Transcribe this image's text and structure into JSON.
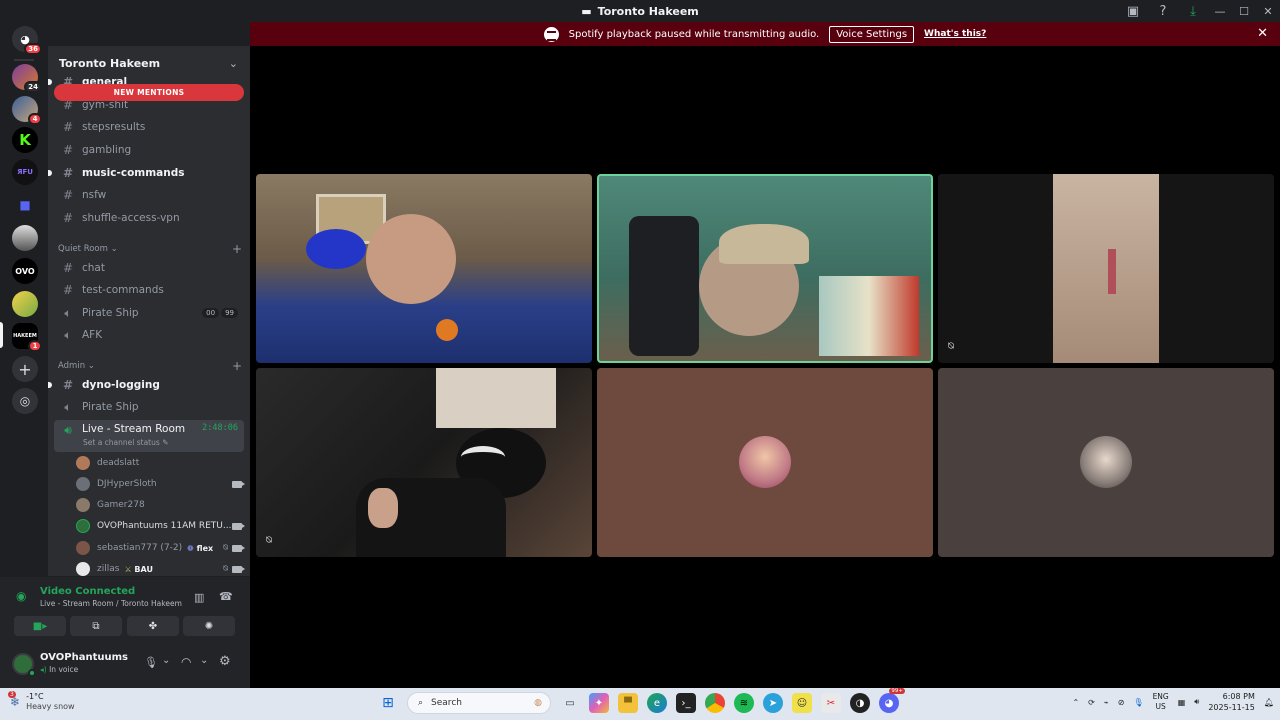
{
  "window": {
    "title": "Toronto Hakeem"
  },
  "notice": {
    "message": "Spotify playback paused while transmitting audio.",
    "button": "Voice Settings",
    "link": "What's this?"
  },
  "rail": {
    "dm_badge": "36",
    "server_badges": {
      "s1": "24",
      "s2": "4",
      "s3": "1"
    }
  },
  "server": {
    "name": "Toronto Hakeem",
    "new_mentions": "NEW MENTIONS"
  },
  "channels_top": [
    {
      "name": "general",
      "type": "text",
      "unread": true
    },
    {
      "name": "gym-shit",
      "type": "text",
      "unread": false
    },
    {
      "name": "stepsresults",
      "type": "text",
      "unread": false
    },
    {
      "name": "gambling",
      "type": "text",
      "unread": false
    },
    {
      "name": "music-commands",
      "type": "text",
      "unread": true
    },
    {
      "name": "nsfw",
      "type": "text",
      "unread": false
    },
    {
      "name": "shuffle-access-vpn",
      "type": "text",
      "unread": false
    }
  ],
  "categories": {
    "quiet_room": "Quiet Room",
    "admin": "Admin"
  },
  "quiet_room_channels": [
    {
      "name": "chat",
      "type": "text"
    },
    {
      "name": "test-commands",
      "type": "text"
    },
    {
      "name": "Pirate Ship",
      "type": "voice",
      "tags": [
        "00",
        "99"
      ]
    },
    {
      "name": "AFK",
      "type": "voice"
    }
  ],
  "admin_channels": [
    {
      "name": "dyno-logging",
      "type": "text",
      "unread": true
    },
    {
      "name": "Pirate Ship",
      "type": "voice"
    }
  ],
  "live_channel": {
    "name": "Live - Stream Room",
    "timer": "2:48:06",
    "status_prompt": "Set a channel status"
  },
  "voice_users": [
    {
      "name": "deadslatt",
      "color": "#b07a5a"
    },
    {
      "name": "DJHyperSloth",
      "color": "#6a6f78",
      "camera": true
    },
    {
      "name": "Gamer278",
      "color": "#8a7a6a"
    },
    {
      "name": "OVOPhantuums 11AM RETU...",
      "color": "#2f6d3a",
      "camera": true
    },
    {
      "name": "sebastian777 (7-2)",
      "color": "#7a5548",
      "tag": "flex",
      "muted": true,
      "camera": true
    },
    {
      "name": "zillas",
      "color": "#e8e8e8",
      "tag": "BAU",
      "muted": true,
      "camera": true
    }
  ],
  "voice_panel": {
    "title": "Video Connected",
    "subtitle": "Live - Stream Room / Toronto Hakeem"
  },
  "user": {
    "name": "OVOPhantuums",
    "status": "In voice"
  },
  "taskbar": {
    "temp": "-1°C",
    "weather": "Heavy snow",
    "weather_badge": "3",
    "search_placeholder": "Search",
    "lang_top": "ENG",
    "lang_bottom": "US",
    "time": "6:08 PM",
    "date": "2025-11-15",
    "discord_badge": "99+"
  },
  "colors": {
    "accent_green": "#23a55a",
    "mention_red": "#da373c",
    "notice_bg": "#59000f",
    "tile_brown": "#6d4a3d",
    "tile_gray": "#4a403e"
  }
}
